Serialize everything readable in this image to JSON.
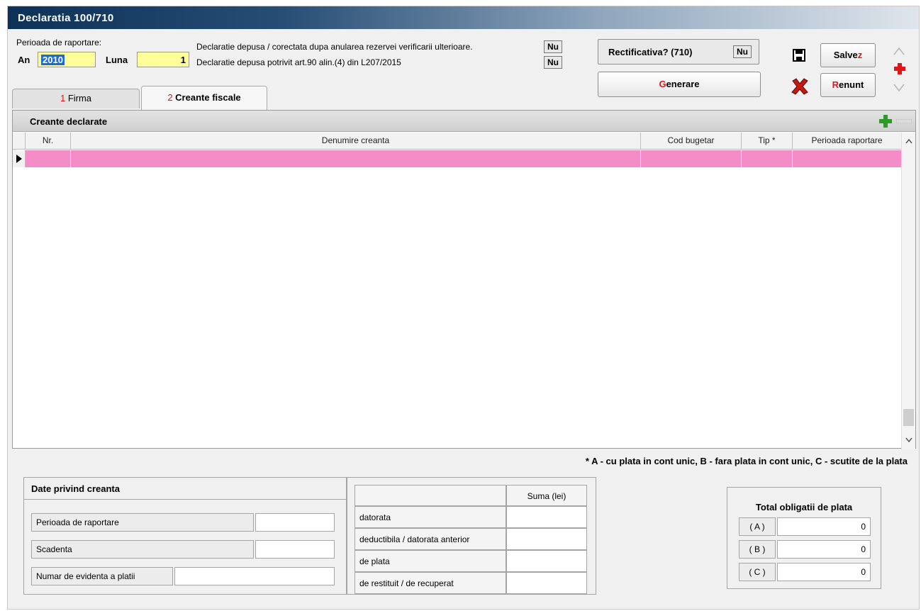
{
  "window": {
    "title": "Declaratia 100/710"
  },
  "period": {
    "label": "Perioada de raportare:",
    "an_label": "An",
    "an_value": "2010",
    "luna_label": "Luna",
    "luna_value": "1"
  },
  "declaratii": {
    "line1": "Declaratie depusa / corectata dupa anularea rezervei verificarii ulterioare.",
    "line1_value": "Nu",
    "line2": "Declaratie depusa potrivit art.90 alin.(4) din L207/2015",
    "line2_value": "Nu"
  },
  "rectificativa": {
    "label": "Rectificativa? (710)",
    "value": "Nu"
  },
  "buttons": {
    "generare_hot": "G",
    "generare_rest": "enerare",
    "salvez_main": "Salve",
    "salvez_hot": "z",
    "renunt_hot": "R",
    "renunt_rest": "enunt"
  },
  "tabs": [
    {
      "num": "1",
      "label": "Firma"
    },
    {
      "num": "2",
      "label": "Creante fiscale"
    }
  ],
  "grid": {
    "title": "Creante declarate",
    "columns": [
      "Nr.",
      "Denumire creanta",
      "Cod bugetar",
      "Tip *",
      "Perioada raportare"
    ]
  },
  "note": "* A - cu plata in cont unic, B - fara plata in cont unic, C - scutite de la plata",
  "date_creanta": {
    "title": "Date privind creanta",
    "perioada": "Perioada de raportare",
    "scadenta": "Scadenta",
    "numar": "Numar de evidenta a platii"
  },
  "sume": {
    "header": "Suma (lei)",
    "rows": [
      "datorata",
      "deductibila / datorata anterior",
      "de plata",
      "de restituit / de recuperat"
    ]
  },
  "total": {
    "title": "Total obligatii de plata",
    "rows": [
      {
        "label": "( A )",
        "value": "0"
      },
      {
        "label": "( B )",
        "value": "0"
      },
      {
        "label": "( C )",
        "value": "0"
      }
    ]
  },
  "colors": {
    "accent_red": "#e01616",
    "row_highlight": "#f48cc8",
    "field_yellow": "#ffff99"
  }
}
